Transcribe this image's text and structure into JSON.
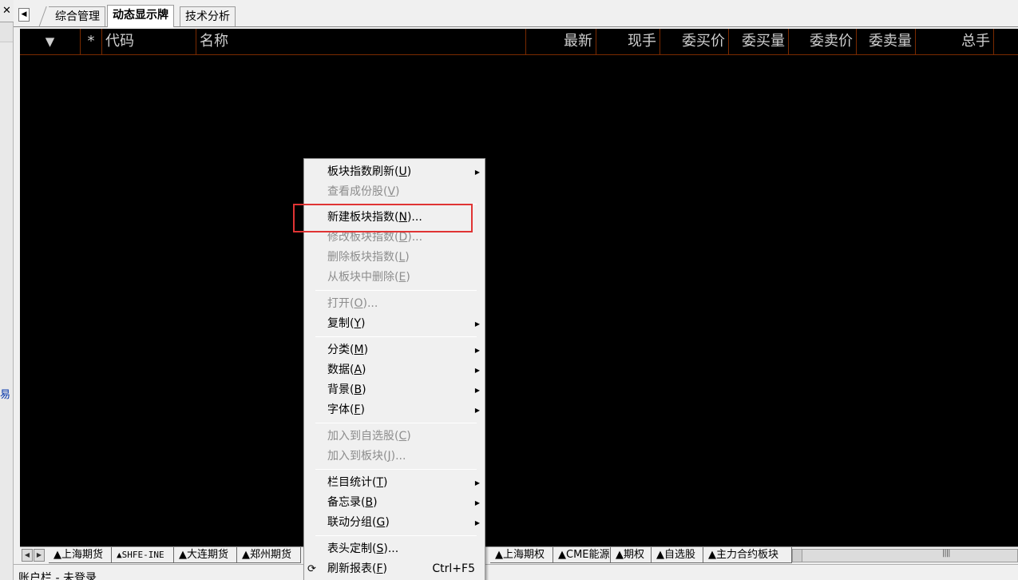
{
  "window": {
    "close_glyph": "✕",
    "left_strip_char": "易"
  },
  "tabs": [
    {
      "label": "综合管理",
      "active": false
    },
    {
      "label": "动态显示牌",
      "active": true
    },
    {
      "label": "技术分析",
      "active": false
    }
  ],
  "table": {
    "columns": [
      {
        "key": "sort",
        "label": "▼"
      },
      {
        "key": "star",
        "label": "*"
      },
      {
        "key": "code",
        "label": "代码"
      },
      {
        "key": "name",
        "label": "名称"
      },
      {
        "key": "latest",
        "label": "最新"
      },
      {
        "key": "current_hand",
        "label": "现手"
      },
      {
        "key": "bid_price",
        "label": "委买价"
      },
      {
        "key": "bid_qty",
        "label": "委买量"
      },
      {
        "key": "ask_price",
        "label": "委卖价"
      },
      {
        "key": "ask_qty",
        "label": "委卖量"
      },
      {
        "key": "volume",
        "label": "总手"
      }
    ],
    "rows": []
  },
  "context_menu": {
    "items": [
      {
        "type": "item",
        "label": "板块指数刷新(",
        "key": "U",
        "suffix": ")",
        "submenu": true,
        "enabled": true
      },
      {
        "type": "item",
        "label": "查看成份股(",
        "key": "V",
        "suffix": ")",
        "submenu": false,
        "enabled": false
      },
      {
        "type": "sep"
      },
      {
        "type": "item",
        "label": "新建板块指数(",
        "key": "N",
        "suffix": ")...",
        "submenu": false,
        "enabled": true,
        "highlighted": true
      },
      {
        "type": "item",
        "label": "修改板块指数(",
        "key": "D",
        "suffix": ")...",
        "submenu": false,
        "enabled": false
      },
      {
        "type": "item",
        "label": "删除板块指数(",
        "key": "L",
        "suffix": ")",
        "submenu": false,
        "enabled": false
      },
      {
        "type": "item",
        "label": "从板块中删除(",
        "key": "E",
        "suffix": ")",
        "submenu": false,
        "enabled": false
      },
      {
        "type": "sep"
      },
      {
        "type": "item",
        "label": "打开(",
        "key": "O",
        "suffix": ")...",
        "submenu": false,
        "enabled": false
      },
      {
        "type": "item",
        "label": "复制(",
        "key": "Y",
        "suffix": ")",
        "submenu": true,
        "enabled": true
      },
      {
        "type": "sep"
      },
      {
        "type": "item",
        "label": "分类(",
        "key": "M",
        "suffix": ")",
        "submenu": true,
        "enabled": true
      },
      {
        "type": "item",
        "label": "数据(",
        "key": "A",
        "suffix": ")",
        "submenu": true,
        "enabled": true
      },
      {
        "type": "item",
        "label": "背景(",
        "key": "B",
        "suffix": ")",
        "submenu": true,
        "enabled": true
      },
      {
        "type": "item",
        "label": "字体(",
        "key": "F",
        "suffix": ")",
        "submenu": true,
        "enabled": true
      },
      {
        "type": "sep"
      },
      {
        "type": "item",
        "label": "加入到自选股(",
        "key": "C",
        "suffix": ")",
        "submenu": false,
        "enabled": false
      },
      {
        "type": "item",
        "label": "加入到板块(",
        "key": "J",
        "suffix": ")...",
        "submenu": false,
        "enabled": false
      },
      {
        "type": "sep"
      },
      {
        "type": "item",
        "label": "栏目统计(",
        "key": "T",
        "suffix": ")",
        "submenu": true,
        "enabled": true
      },
      {
        "type": "item",
        "label": "备忘录(",
        "key": "B",
        "suffix": ")",
        "submenu": true,
        "enabled": true
      },
      {
        "type": "item",
        "label": "联动分组(",
        "key": "G",
        "suffix": ")",
        "submenu": true,
        "enabled": true
      },
      {
        "type": "sep"
      },
      {
        "type": "item",
        "label": "表头定制(",
        "key": "S",
        "suffix": ")...",
        "submenu": false,
        "enabled": true
      },
      {
        "type": "item",
        "label": "刷新报表(",
        "key": "F",
        "suffix": ")",
        "submenu": false,
        "enabled": true,
        "shortcut": "Ctrl+F5",
        "icon": "refresh-icon"
      }
    ],
    "highlight_color": "#e03434"
  },
  "sheet_tabs": [
    {
      "label": "▲上海期货",
      "mono": false
    },
    {
      "label": "▲SHFE-INE",
      "mono": true
    },
    {
      "label": "▲大连期货",
      "mono": false
    },
    {
      "label": "▲郑州期货",
      "mono": false
    },
    {
      "label": "▲上海期权",
      "mono": false
    },
    {
      "label": "▲CME能源",
      "mono": false
    },
    {
      "label": "▲期权",
      "mono": false
    },
    {
      "label": "▲自选股",
      "mono": false
    },
    {
      "label": "▲主力合约板块",
      "mono": false
    }
  ],
  "status_bar": {
    "text": "账户栏 - 未登录"
  },
  "colors": {
    "background": "#000000",
    "header_text": "#cfcfcf",
    "grid_line": "#7a2a00",
    "disabled_text": "#8d8d8d"
  }
}
